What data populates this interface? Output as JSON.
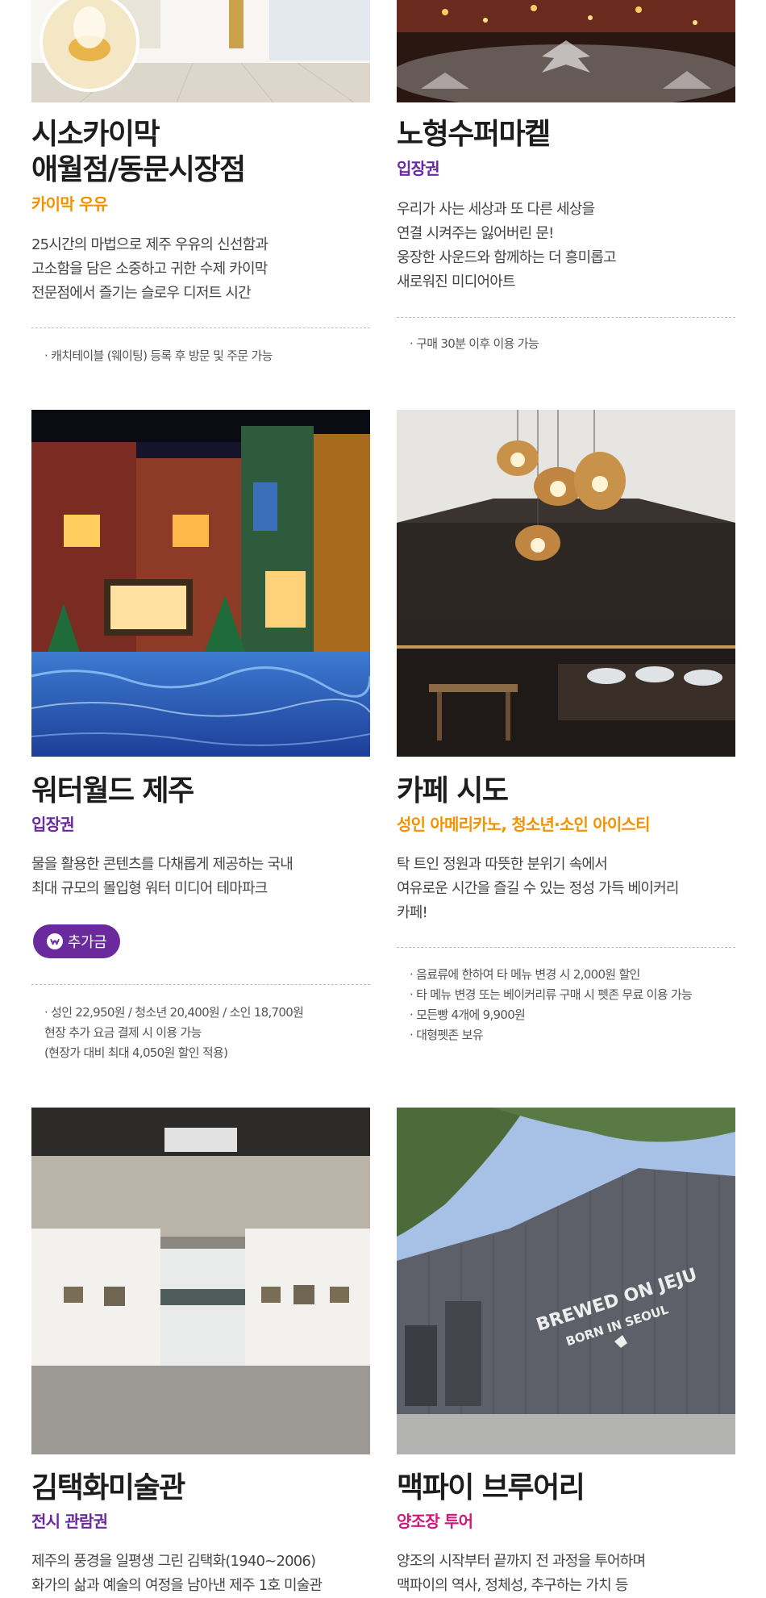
{
  "colors": {
    "purple": "#6a2a9e",
    "orange": "#f39200",
    "magenta": "#d0187a",
    "title": "#1d1d1d",
    "text": "#444444"
  },
  "cards": [
    {
      "title_lines": [
        "시소카이막",
        "애월점/동문시장점"
      ],
      "subtitle": "카이막 우유",
      "subtitle_color": "orange",
      "desc": [
        "25시간의 마법으로 제주 우유의 신선함과",
        "고소함을 담은 소중하고 귀한 수제 카이막",
        "전문점에서 즐기는 슬로우 디저트 시간"
      ],
      "notes": [
        "· 캐치테이블 (웨이팅) 등록 후 방문 및 주문 가능"
      ]
    },
    {
      "title_lines": [
        "노형수퍼마켙"
      ],
      "subtitle": "입장권",
      "subtitle_color": "purple",
      "desc": [
        "우리가 사는 세상과 또 다른 세상을",
        "연결 시켜주는 잃어버린 문!",
        "웅장한 사운드와 함께하는 더 흥미롭고",
        "새로워진 미디어아트"
      ],
      "notes": [
        "· 구매 30분 이후 이용 가능"
      ]
    },
    {
      "title_lines": [
        "워터월드 제주"
      ],
      "subtitle": "입장권",
      "subtitle_color": "purple",
      "desc": [
        "물을 활용한 콘텐츠를 다채롭게 제공하는 국내",
        "최대 규모의 몰입형 워터 미디어 테마파크"
      ],
      "badge": "추가금",
      "notes": [
        "· 성인 22,950원 / 청소년 20,400원 / 소인 18,700원",
        "  현장 추가 요금 결제 시 이용 가능",
        "  (현장가 대비 최대 4,050원 할인 적용)"
      ]
    },
    {
      "title_lines": [
        "카페 시도"
      ],
      "subtitle": "성인 아메리카노, 청소년·소인 아이스티",
      "subtitle_color": "orange",
      "desc": [
        "탁 트인 정원과 따뜻한 분위기 속에서",
        "여유로운 시간을 즐길 수 있는 정성 가득 베이커리",
        "카페!"
      ],
      "notes": [
        "· 음료류에 한하여 타 메뉴 변경 시 2,000원 할인",
        "· 타 메뉴 변경 또는 베이커리류 구매 시 펫존 무료 이용 가능",
        "· 모든빵 4개에 9,900원",
        "· 대형펫존 보유"
      ]
    },
    {
      "title_lines": [
        "김택화미술관"
      ],
      "subtitle": "전시 관람권",
      "subtitle_color": "purple",
      "desc": [
        "제주의 풍경을 일평생 그린 김택화(1940~2006)",
        "화가의 삶과 예술의 여정을 남아낸 제주 1호 미술관"
      ]
    },
    {
      "title_lines": [
        "맥파이 브루어리"
      ],
      "subtitle": "양조장 투어",
      "subtitle_color": "magenta",
      "desc": [
        "양조의 시작부터 끝까지 전 과정을 투어하며",
        "맥파이의 역사, 정체성, 추구하는 가치 등"
      ],
      "sign": {
        "top": "BREWED ON JEJU",
        "bottom": "BORN IN SEOUL"
      }
    }
  ]
}
